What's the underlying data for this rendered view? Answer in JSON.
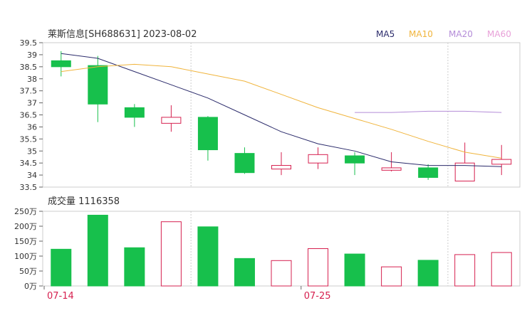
{
  "title": "莱斯信息[SH688631] 2023-08-02",
  "legend": [
    {
      "label": "MA5",
      "color": "#2b2b6b"
    },
    {
      "label": "MA10",
      "color": "#f0b43c"
    },
    {
      "label": "MA20",
      "color": "#b48cd8"
    },
    {
      "label": "MA60",
      "color": "#e8a0d8"
    }
  ],
  "volume_title": "成交量 1116358",
  "colors": {
    "up": "#d6204f",
    "down": "#17c04c",
    "axis": "#999999",
    "grid": "#dddddd"
  },
  "chart_data": [
    {
      "type": "candlestick",
      "title": "莱斯信息[SH688631] 2023-08-02",
      "ylim": [
        33.5,
        39.5
      ],
      "yticks": [
        "39.5",
        "39",
        "38.5",
        "38",
        "37.5",
        "37",
        "36.5",
        "36",
        "35.5",
        "35",
        "34.5",
        "34",
        "33.5"
      ],
      "x_labels": [
        "07-14",
        "07-25"
      ],
      "x_label_index": [
        0,
        7
      ],
      "candles": [
        {
          "open": 38.75,
          "close": 38.5,
          "high": 39.15,
          "low": 38.1
        },
        {
          "open": 38.55,
          "close": 36.95,
          "high": 38.95,
          "low": 36.2
        },
        {
          "open": 36.8,
          "close": 36.4,
          "high": 36.95,
          "low": 36.0
        },
        {
          "open": 36.15,
          "close": 36.4,
          "high": 36.9,
          "low": 35.8
        },
        {
          "open": 36.4,
          "close": 35.05,
          "high": 36.45,
          "low": 34.6
        },
        {
          "open": 34.9,
          "close": 34.1,
          "high": 35.15,
          "low": 34.05
        },
        {
          "open": 34.25,
          "close": 34.4,
          "high": 34.95,
          "low": 34.0
        },
        {
          "open": 34.5,
          "close": 34.85,
          "high": 35.15,
          "low": 34.25
        },
        {
          "open": 34.8,
          "close": 34.5,
          "high": 34.95,
          "low": 34.0
        },
        {
          "open": 34.2,
          "close": 34.3,
          "high": 34.95,
          "low": 34.15
        },
        {
          "open": 34.3,
          "close": 33.9,
          "high": 34.45,
          "low": 33.8
        },
        {
          "open": 33.75,
          "close": 34.5,
          "high": 35.35,
          "low": 33.75
        },
        {
          "open": 34.45,
          "close": 34.65,
          "high": 35.25,
          "low": 34.0
        }
      ],
      "series": [
        {
          "name": "MA5",
          "values": [
            39.05,
            38.85,
            38.3,
            37.75,
            37.2,
            36.5,
            35.8,
            35.3,
            35.0,
            34.55,
            34.4,
            34.4,
            34.35
          ]
        },
        {
          "name": "MA10",
          "values": [
            38.3,
            38.5,
            38.6,
            38.5,
            38.2,
            37.9,
            37.35,
            36.8,
            36.35,
            35.9,
            35.4,
            34.95,
            34.7
          ]
        },
        {
          "name": "MA20",
          "values": [
            null,
            null,
            null,
            null,
            null,
            null,
            null,
            null,
            36.6,
            36.6,
            36.65,
            36.65,
            36.6
          ]
        },
        {
          "name": "MA60",
          "values": [
            null,
            null,
            null,
            null,
            null,
            null,
            null,
            null,
            null,
            null,
            null,
            null,
            null
          ]
        }
      ]
    },
    {
      "type": "bar",
      "title": "成交量 1116358",
      "ylim": [
        0,
        250
      ],
      "yticks": [
        "250万",
        "200万",
        "150万",
        "100万",
        "50万",
        "0万"
      ],
      "values": [
        123,
        237,
        128,
        215,
        198,
        92,
        85,
        125,
        107,
        64,
        86,
        105,
        112
      ],
      "direction": [
        "down",
        "down",
        "down",
        "up",
        "down",
        "down",
        "up",
        "up",
        "down",
        "up",
        "down",
        "up",
        "up"
      ]
    }
  ]
}
